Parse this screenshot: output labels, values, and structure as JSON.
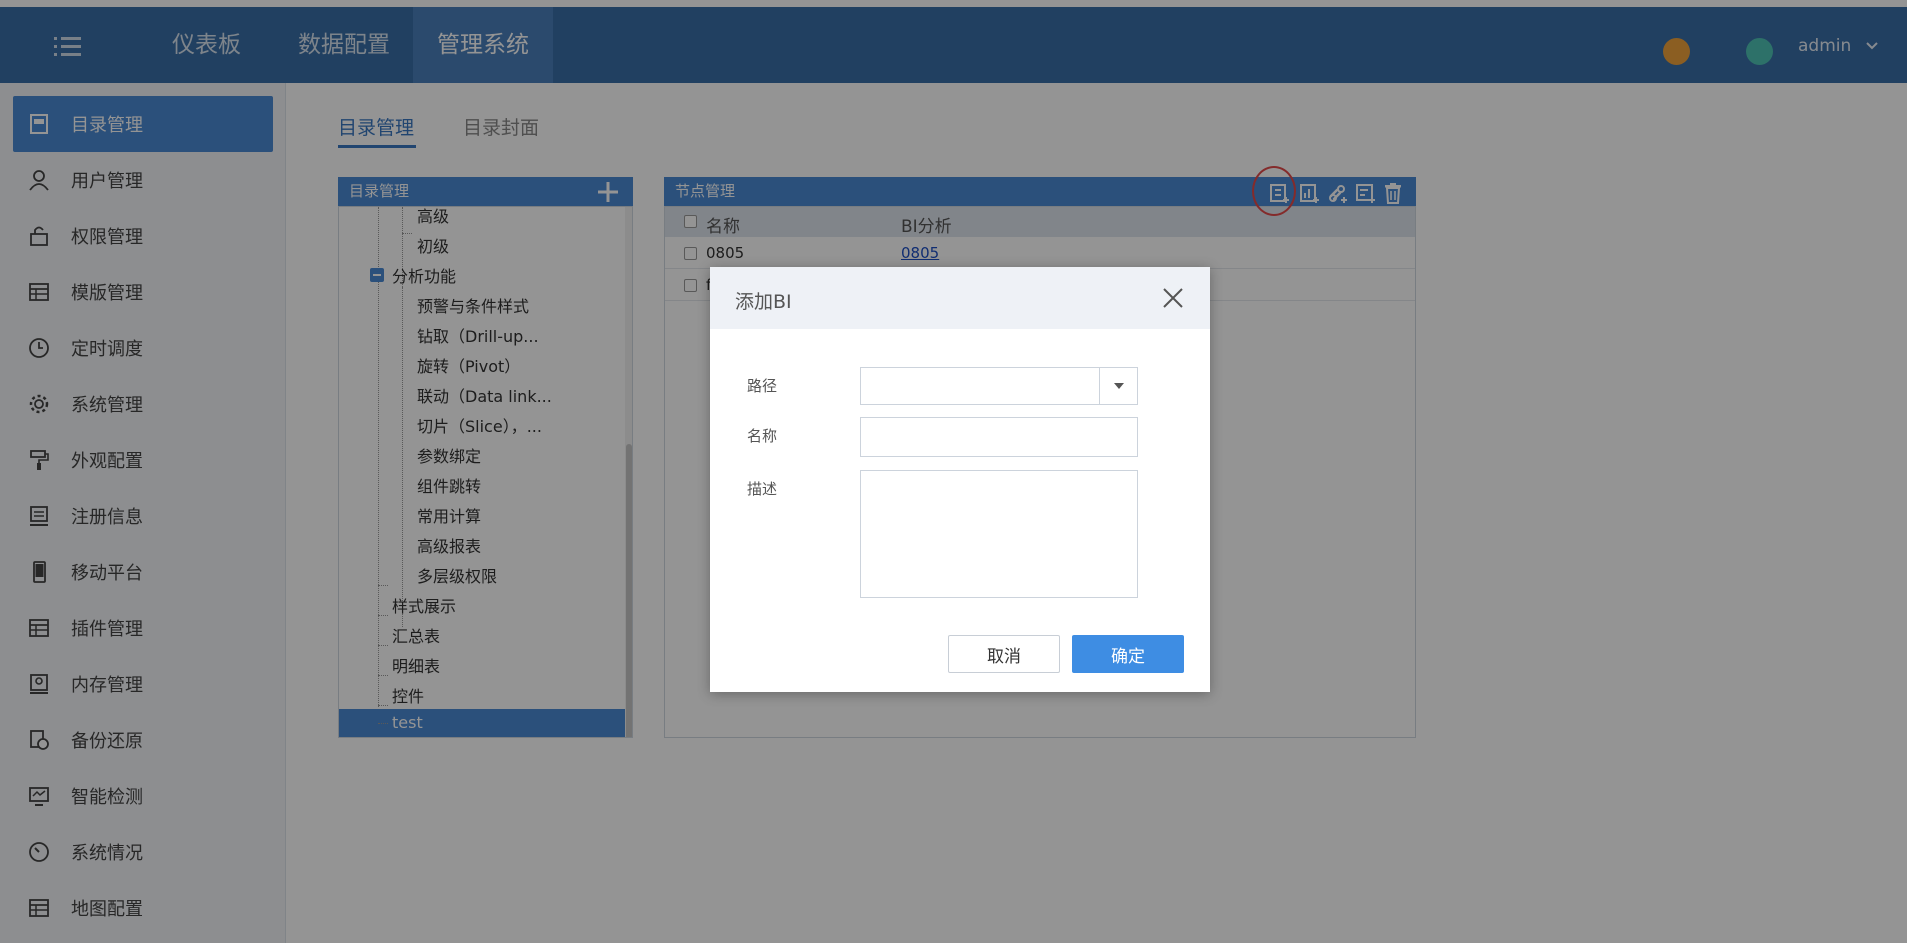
{
  "topbar": {
    "tabs": [
      {
        "label": "仪表板"
      },
      {
        "label": "数据配置"
      },
      {
        "label": "管理系统"
      }
    ],
    "user": "admin"
  },
  "sidebar": {
    "items": [
      {
        "label": "目录管理"
      },
      {
        "label": "用户管理"
      },
      {
        "label": "权限管理"
      },
      {
        "label": "模版管理"
      },
      {
        "label": "定时调度"
      },
      {
        "label": "系统管理"
      },
      {
        "label": "外观配置"
      },
      {
        "label": "注册信息"
      },
      {
        "label": "移动平台"
      },
      {
        "label": "插件管理"
      },
      {
        "label": "内存管理"
      },
      {
        "label": "备份还原"
      },
      {
        "label": "智能检测"
      },
      {
        "label": "系统情况"
      },
      {
        "label": "地图配置"
      }
    ]
  },
  "main": {
    "tabs": [
      {
        "label": "目录管理"
      },
      {
        "label": "目录封面"
      }
    ],
    "tree": {
      "title": "目录管理",
      "nodes": [
        {
          "label": "高级"
        },
        {
          "label": "初级"
        },
        {
          "label": "分析功能"
        },
        {
          "label": "预警与条件样式"
        },
        {
          "label": "钻取（Drill-up..."
        },
        {
          "label": "旋转（Pivot）"
        },
        {
          "label": "联动（Data link..."
        },
        {
          "label": "切片（Slice），..."
        },
        {
          "label": "参数绑定"
        },
        {
          "label": "组件跳转"
        },
        {
          "label": "常用计算"
        },
        {
          "label": "高级报表"
        },
        {
          "label": "多层级权限"
        },
        {
          "label": "样式展示"
        },
        {
          "label": "汇总表"
        },
        {
          "label": "明细表"
        },
        {
          "label": "控件"
        },
        {
          "label": "test"
        }
      ]
    },
    "node_panel": {
      "title": "节点管理",
      "columns": [
        "名称",
        "BI分析"
      ],
      "rows": [
        {
          "name": "0805",
          "bi": "0805"
        },
        {
          "name": "f",
          "bi": ""
        }
      ]
    }
  },
  "dialog": {
    "title": "添加BI",
    "fields": [
      {
        "label": "路径",
        "value": ""
      },
      {
        "label": "名称",
        "value": ""
      },
      {
        "label": "描述",
        "value": ""
      }
    ],
    "cancel_label": "取消",
    "ok_label": "确定"
  },
  "colors": {
    "topbar": "#3a6fa8",
    "accent": "#4a8ad4",
    "primary_button": "#3e8de3",
    "highlight_circle": "#e34a4a"
  }
}
